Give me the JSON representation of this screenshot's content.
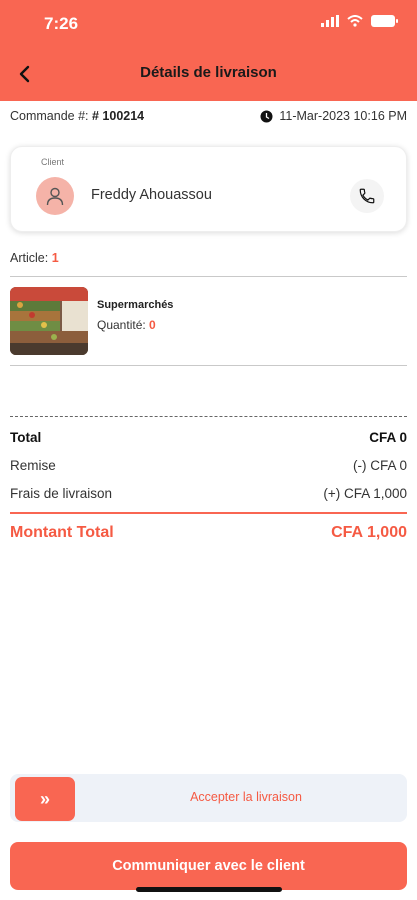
{
  "status_bar": {
    "time": "7:26"
  },
  "header": {
    "title": "Détails de livraison"
  },
  "order": {
    "label": "Commande #:",
    "number": "# 100214",
    "datetime": "11-Mar-2023 10:16 PM"
  },
  "client": {
    "label": "Client",
    "name": "Freddy Ahouassou"
  },
  "article": {
    "label": "Article:",
    "count": "1"
  },
  "item": {
    "name": "Supermarchés",
    "quantity_label": "Quantité:",
    "quantity": "0"
  },
  "summary": {
    "total_label": "Total",
    "total_value": "CFA 0",
    "discount_label": "Remise",
    "discount_value": "(-) CFA 0",
    "delivery_label": "Frais de livraison",
    "delivery_value": "(+) CFA 1,000",
    "grand_total_label": "Montant Total",
    "grand_total_value": "CFA 1,000"
  },
  "actions": {
    "slide_label": "Accepter la livraison",
    "slide_handle_icon": "»",
    "contact_label": "Communiquer avec le client"
  },
  "colors": {
    "accent": "#F96652",
    "accent_text": "#F55A43"
  }
}
